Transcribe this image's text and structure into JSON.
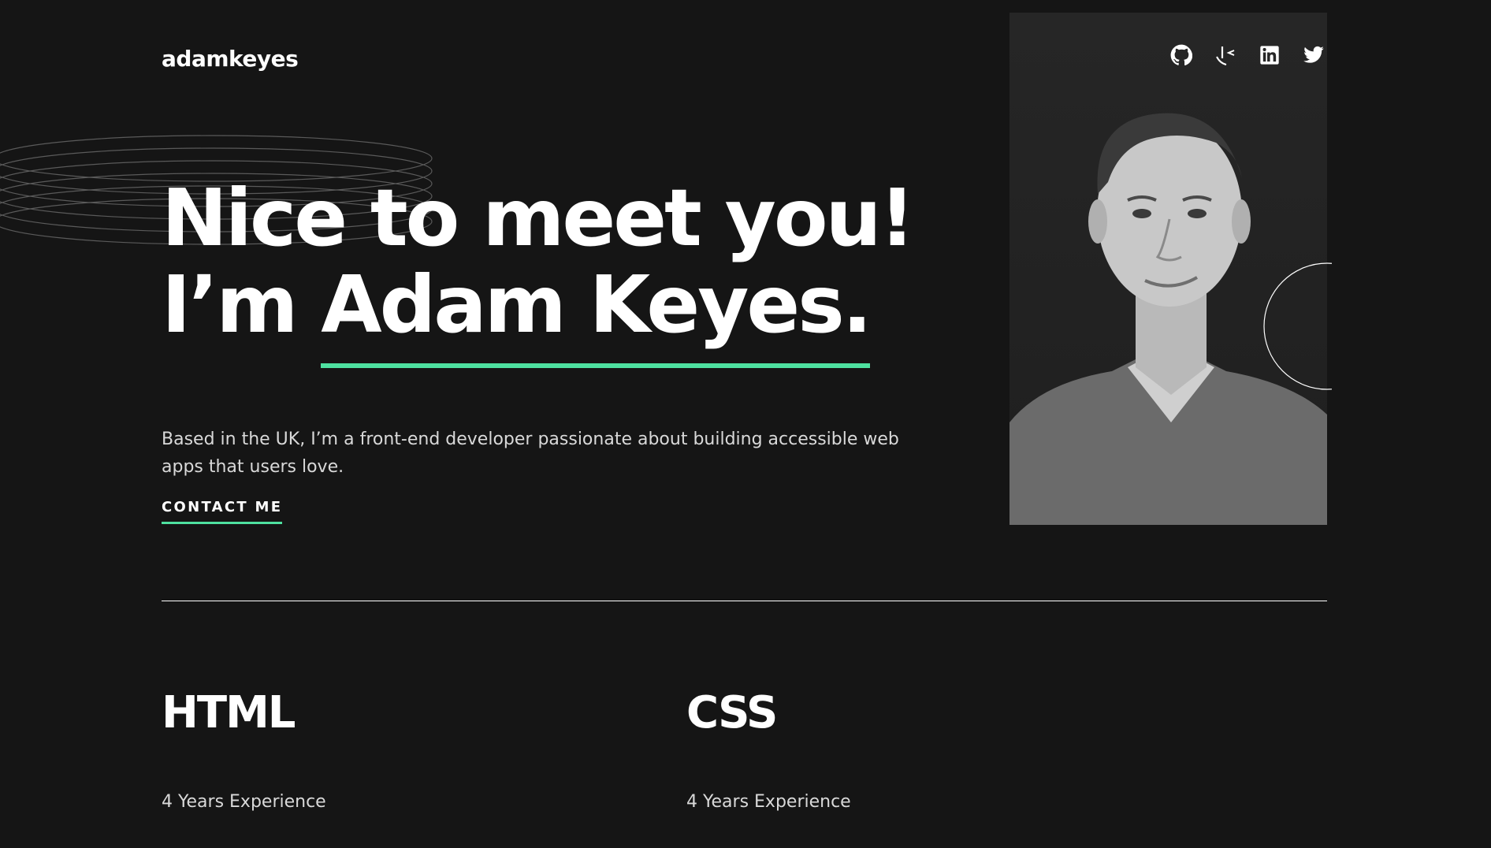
{
  "header": {
    "logo": "adamkeyes",
    "socials": [
      {
        "icon": "github-icon"
      },
      {
        "icon": "frontend-mentor-icon"
      },
      {
        "icon": "linkedin-icon"
      },
      {
        "icon": "twitter-icon"
      }
    ]
  },
  "hero": {
    "line1": "Nice to meet you!",
    "line2_prefix": "I’m ",
    "line2_name": "Adam Keyes.",
    "intro": "Based in the UK, I’m a front-end developer passionate about building accessible web apps that users love.",
    "cta": "CONTACT ME"
  },
  "skills": [
    {
      "name": "HTML",
      "experience": "4 Years Experience"
    },
    {
      "name": "CSS",
      "experience": "4 Years Experience"
    }
  ],
  "colors": {
    "background": "#151515",
    "accent": "#4ee1a0",
    "text": "#ffffff",
    "muted": "#d9d9d9"
  }
}
